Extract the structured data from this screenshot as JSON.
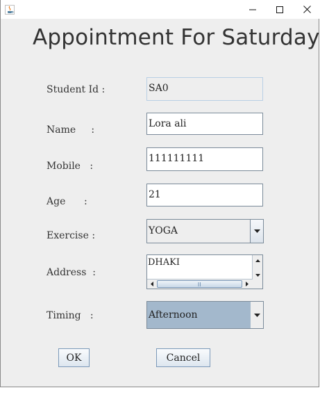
{
  "window": {
    "minimize_glyph": "–",
    "maximize_glyph": "☐",
    "close_glyph": "✕"
  },
  "form": {
    "title": "Appointment For Saturday",
    "labels": {
      "student_id": "Student Id :",
      "name": "Name     :",
      "mobile": "Mobile   :",
      "age": "Age      :",
      "exercise": "Exercise :",
      "address": "Address  :",
      "timing": "Timing   :"
    },
    "values": {
      "student_id": "SA0",
      "name": "Lora ali",
      "mobile": "111111111",
      "age": "21",
      "exercise": "YOGA",
      "address": "DHAKI",
      "timing": "Afternoon"
    }
  },
  "buttons": {
    "ok": "OK",
    "cancel": "Cancel"
  },
  "icons": {
    "app": "java-coffee-icon",
    "dropdown": "chevron-down-icon"
  }
}
